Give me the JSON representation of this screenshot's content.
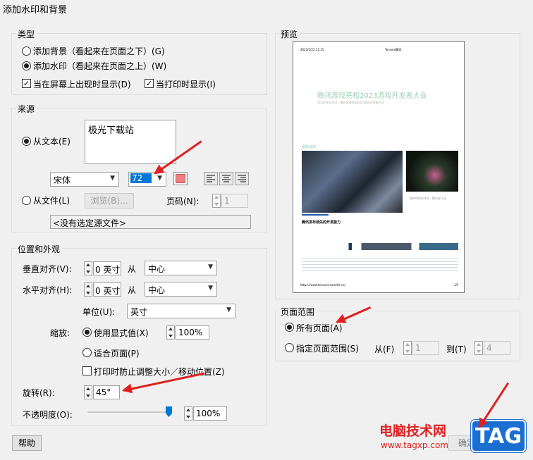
{
  "window": {
    "title": "添加水印和背景"
  },
  "type_group": {
    "label": "类型",
    "add_background": "添加背景（看起来在页面之下）(G)",
    "add_watermark": "添加水印（看起来在页面之上）(W)",
    "show_on_screen": "当在屏幕上出现时显示(D)",
    "show_on_print": "当打印时显示(I)"
  },
  "source_group": {
    "label": "来源",
    "from_text": "从文本(E)",
    "text_value": "极光下载站",
    "font": "宋体",
    "font_size": "72",
    "color": "#f08080",
    "from_file": "从文件(L)",
    "browse": "浏览(B)...",
    "page_label": "页码(N):",
    "page_value": "1",
    "no_file": "<没有选定源文件>"
  },
  "position_group": {
    "label": "位置和外观",
    "vertical": "垂直对齐(V):",
    "vertical_value": "0 英寸",
    "from1": "从",
    "vertical_from": "中心",
    "horizontal": "水平对齐(H):",
    "horizontal_value": "0 英寸",
    "from2": "从",
    "horizontal_from": "中心",
    "unit_label": "单位(U):",
    "unit_value": "英寸",
    "scale_label": "缩放:",
    "use_display": "使用显式值(X)",
    "scale_value": "100%",
    "fit_page": "适合页面(P)",
    "prevent_resize": "打印时防止调整大小／移动位置(Z)",
    "rotation_label": "旋转(R):",
    "rotation_value": "45°",
    "opacity_label": "不透明度(O):",
    "opacity_value": "100%",
    "opacity_level": 1.0
  },
  "preview_group": {
    "label": "预览",
    "header_left": "2023/5/22 11:15",
    "header_right": "Tencent腾讯",
    "headline": "腾讯游戏亮相2023游戏开发者大会",
    "subline": "3月20日至24日，腾讯游戏亮相2023游戏开发者大会",
    "section": "最新动态",
    "side_title": "保护你的多样性 · 腾讯在行动",
    "article_title": "腾讯发布领先的开发能力",
    "footer_url": "https://www.tencent.com/zh-cn/",
    "footer_page": "1/3"
  },
  "page_range_group": {
    "label": "页面范围",
    "all_pages": "所有页面(A)",
    "specify_range": "指定页面范围(S)",
    "from_label": "从(F)",
    "from_value": "1",
    "to_label": "到(T)",
    "to_value": "4"
  },
  "buttons": {
    "help": "帮助",
    "ok": "确定"
  },
  "watermark_overlay": {
    "site_name": "电脑技术网",
    "site_url": "www.tagxp.com",
    "logo": "TAG"
  },
  "colors": {
    "arrow": "#e02020",
    "accent": "#0078d7"
  }
}
